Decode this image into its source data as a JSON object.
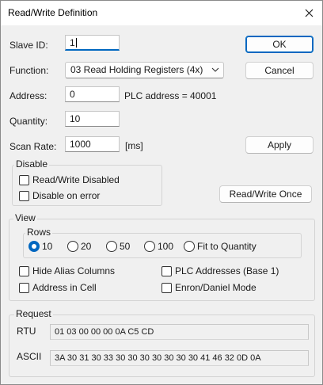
{
  "window": {
    "title": "Read/Write Definition"
  },
  "form": {
    "slave_id": {
      "label": "Slave ID:",
      "value": "1"
    },
    "function": {
      "label": "Function:",
      "value": "03 Read Holding Registers (4x)"
    },
    "address": {
      "label": "Address:",
      "value": "0",
      "plc_note": "PLC address = 40001"
    },
    "quantity": {
      "label": "Quantity:",
      "value": "10"
    },
    "scan_rate": {
      "label": "Scan Rate:",
      "value": "1000",
      "unit": "[ms]"
    }
  },
  "buttons": {
    "ok": "OK",
    "cancel": "Cancel",
    "apply": "Apply",
    "rw_once": "Read/Write Once"
  },
  "disable": {
    "title": "Disable",
    "rw_disabled": "Read/Write Disabled",
    "on_error": "Disable on error"
  },
  "view": {
    "title": "View",
    "rows_title": "Rows",
    "rows_options": [
      "10",
      "20",
      "50",
      "100",
      "Fit to Quantity"
    ],
    "rows_selected": "10",
    "hide_alias": "Hide Alias Columns",
    "address_in_cell": "Address in Cell",
    "plc_addresses": "PLC Addresses (Base 1)",
    "enron": "Enron/Daniel Mode"
  },
  "request": {
    "title": "Request",
    "rtu_label": "RTU",
    "rtu_value": "01 03 00 00 00 0A C5 CD",
    "ascii_label": "ASCII",
    "ascii_value": "3A 30 31 30 33 30 30 30 30 30 30 30 41 46 32 0D 0A"
  },
  "colors": {
    "accent": "#0067c0",
    "dialog_bg": "#f0f0f0"
  }
}
